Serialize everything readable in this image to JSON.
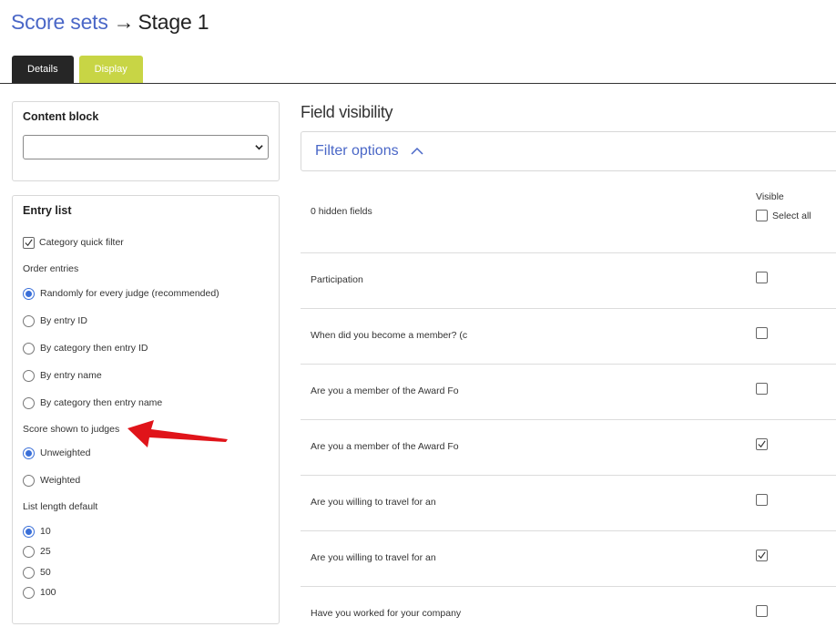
{
  "breadcrumb": {
    "parent": "Score sets",
    "separator": "→",
    "current": "Stage 1"
  },
  "tabs": [
    {
      "label": "Details",
      "active": true
    },
    {
      "label": "Display",
      "active": false
    }
  ],
  "content_block": {
    "title": "Content block",
    "select_value": ""
  },
  "entry_list": {
    "title": "Entry list",
    "category_quick_filter": {
      "label": "Category quick filter",
      "checked": true
    },
    "order_entries": {
      "label": "Order entries",
      "options": [
        {
          "label": "Randomly for every judge (recommended)",
          "selected": true
        },
        {
          "label": "By entry ID",
          "selected": false
        },
        {
          "label": "By category then entry ID",
          "selected": false
        },
        {
          "label": "By entry name",
          "selected": false
        },
        {
          "label": "By category then entry name",
          "selected": false
        }
      ]
    },
    "score_shown": {
      "label": "Score shown to judges",
      "options": [
        {
          "label": "Unweighted",
          "selected": true
        },
        {
          "label": "Weighted",
          "selected": false
        }
      ]
    },
    "list_length": {
      "label": "List length default",
      "options": [
        {
          "label": "10",
          "selected": true
        },
        {
          "label": "25",
          "selected": false
        },
        {
          "label": "50",
          "selected": false
        },
        {
          "label": "100",
          "selected": false
        }
      ]
    }
  },
  "field_visibility": {
    "title": "Field visibility",
    "filter_label": "Filter options",
    "hidden_count": "0 hidden fields",
    "visible_header": "Visible",
    "select_all": "Select all",
    "rows": [
      {
        "label": "Participation",
        "checked": false
      },
      {
        "label": "When did you become a member? (c",
        "checked": false
      },
      {
        "label": "Are you a member of the Award Fo",
        "checked": false
      },
      {
        "label": "Are you a member of the Award Fo",
        "checked": true
      },
      {
        "label": "Are you willing to travel for an",
        "checked": false
      },
      {
        "label": "Are you willing to travel for an",
        "checked": true
      },
      {
        "label": "Have you worked for your company",
        "checked": false
      }
    ]
  },
  "colors": {
    "link": "#4a67c7",
    "tab_active": "#262626",
    "tab_display": "#c8d545",
    "radio_on": "#3a6fd8",
    "annotation_arrow": "#e0141a"
  }
}
